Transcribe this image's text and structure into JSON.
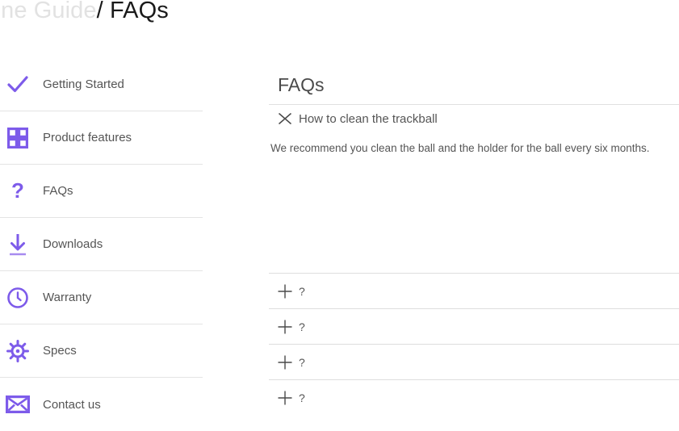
{
  "breadcrumb": {
    "site": "line Guide",
    "separator": "/",
    "current": "FAQs"
  },
  "colors": {
    "accent": "#7d5bea",
    "accent_soft": "#cbb9f7",
    "text": "#555555",
    "heading": "#4a4a4a",
    "divider": "#e0e0e0",
    "breadcrumb_muted": "#e2e2e2"
  },
  "sidebar": {
    "items": [
      {
        "label": "Getting Started",
        "icon": "checkmark-icon"
      },
      {
        "label": "Product features",
        "icon": "grid-squares-icon"
      },
      {
        "label": "FAQs",
        "icon": "question-mark-icon"
      },
      {
        "label": "Downloads",
        "icon": "download-arrow-icon"
      },
      {
        "label": "Warranty",
        "icon": "clock-badge-icon"
      },
      {
        "label": "Specs",
        "icon": "gear-icon"
      },
      {
        "label": "Contact us",
        "icon": "envelope-icon"
      }
    ]
  },
  "main": {
    "title": "FAQs",
    "expanded_item": {
      "toggle_icon": "close-x-icon",
      "question": "How to clean the trackball",
      "answer": "We recommend you clean the ball and the holder for the ball every six months."
    },
    "collapsed_items": [
      {
        "toggle_icon": "plus-icon",
        "question": "?"
      },
      {
        "toggle_icon": "plus-icon",
        "question": "?"
      },
      {
        "toggle_icon": "plus-icon",
        "question": "?"
      },
      {
        "toggle_icon": "plus-icon",
        "question": "?"
      }
    ]
  }
}
